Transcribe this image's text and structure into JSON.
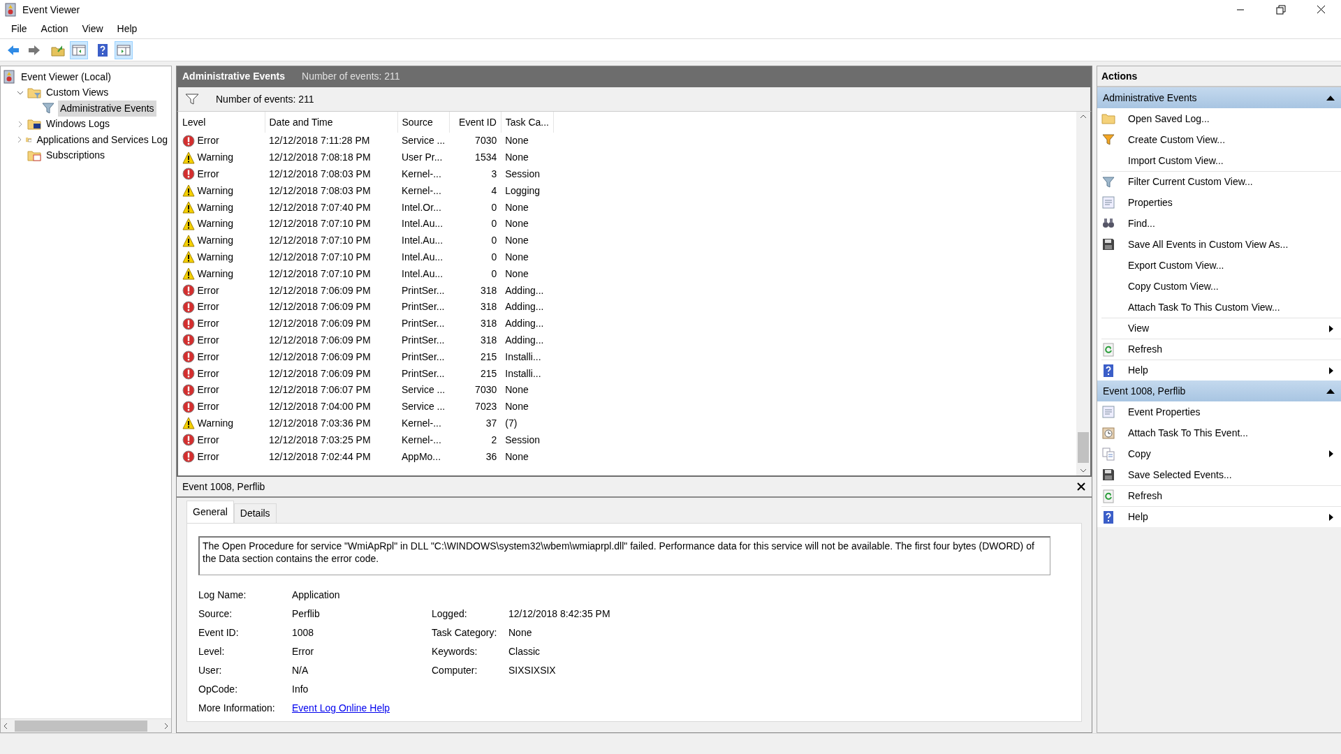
{
  "window": {
    "title": "Event Viewer"
  },
  "menu": [
    "File",
    "Action",
    "View",
    "Help"
  ],
  "toolbar": [
    {
      "pressed": false
    },
    {
      "pressed": false
    },
    {
      "pressed": false
    },
    {
      "pressed": true
    },
    {
      "pressed": false
    },
    {
      "pressed": true
    }
  ],
  "tree": [
    {
      "label": "Event Viewer (Local)",
      "selected": false,
      "children": [
        {
          "label": "Custom Views",
          "selected": false,
          "expanded": true,
          "children": [
            {
              "label": "Administrative Events",
              "selected": true
            }
          ]
        },
        {
          "label": "Windows Logs",
          "selected": false,
          "expanded": false
        },
        {
          "label": "Applications and Services Log",
          "selected": false,
          "expanded": false
        },
        {
          "label": "Subscriptions",
          "selected": false
        }
      ]
    }
  ],
  "center": {
    "title": "Administrative Events",
    "subtitle": "Number of events: 211",
    "filter_text": "Number of events: 211",
    "columns": [
      "Level",
      "Date and Time",
      "Source",
      "Event ID",
      "Task Ca..."
    ],
    "rows": [
      {
        "kind": "error",
        "cells": [
          "Error",
          "12/12/2018 7:11:28 PM",
          "Service ...",
          "7030",
          "None"
        ]
      },
      {
        "kind": "warning",
        "cells": [
          "Warning",
          "12/12/2018 7:08:18 PM",
          "User Pr...",
          "1534",
          "None"
        ]
      },
      {
        "kind": "error",
        "cells": [
          "Error",
          "12/12/2018 7:08:03 PM",
          "Kernel-...",
          "3",
          "Session"
        ]
      },
      {
        "kind": "warning",
        "cells": [
          "Warning",
          "12/12/2018 7:08:03 PM",
          "Kernel-...",
          "4",
          "Logging"
        ]
      },
      {
        "kind": "warning",
        "cells": [
          "Warning",
          "12/12/2018 7:07:40 PM",
          "Intel.Or...",
          "0",
          "None"
        ]
      },
      {
        "kind": "warning",
        "cells": [
          "Warning",
          "12/12/2018 7:07:10 PM",
          "Intel.Au...",
          "0",
          "None"
        ]
      },
      {
        "kind": "warning",
        "cells": [
          "Warning",
          "12/12/2018 7:07:10 PM",
          "Intel.Au...",
          "0",
          "None"
        ]
      },
      {
        "kind": "warning",
        "cells": [
          "Warning",
          "12/12/2018 7:07:10 PM",
          "Intel.Au...",
          "0",
          "None"
        ]
      },
      {
        "kind": "warning",
        "cells": [
          "Warning",
          "12/12/2018 7:07:10 PM",
          "Intel.Au...",
          "0",
          "None"
        ]
      },
      {
        "kind": "error",
        "cells": [
          "Error",
          "12/12/2018 7:06:09 PM",
          "PrintSer...",
          "318",
          "Adding..."
        ]
      },
      {
        "kind": "error",
        "cells": [
          "Error",
          "12/12/2018 7:06:09 PM",
          "PrintSer...",
          "318",
          "Adding..."
        ]
      },
      {
        "kind": "error",
        "cells": [
          "Error",
          "12/12/2018 7:06:09 PM",
          "PrintSer...",
          "318",
          "Adding..."
        ]
      },
      {
        "kind": "error",
        "cells": [
          "Error",
          "12/12/2018 7:06:09 PM",
          "PrintSer...",
          "318",
          "Adding..."
        ]
      },
      {
        "kind": "error",
        "cells": [
          "Error",
          "12/12/2018 7:06:09 PM",
          "PrintSer...",
          "215",
          "Installi..."
        ]
      },
      {
        "kind": "error",
        "cells": [
          "Error",
          "12/12/2018 7:06:09 PM",
          "PrintSer...",
          "215",
          "Installi..."
        ]
      },
      {
        "kind": "error",
        "cells": [
          "Error",
          "12/12/2018 7:06:07 PM",
          "Service ...",
          "7030",
          "None"
        ]
      },
      {
        "kind": "error",
        "cells": [
          "Error",
          "12/12/2018 7:04:00 PM",
          "Service ...",
          "7023",
          "None"
        ]
      },
      {
        "kind": "warning",
        "cells": [
          "Warning",
          "12/12/2018 7:03:36 PM",
          "Kernel-...",
          "37",
          "(7)"
        ]
      },
      {
        "kind": "error",
        "cells": [
          "Error",
          "12/12/2018 7:03:25 PM",
          "Kernel-...",
          "2",
          "Session"
        ]
      },
      {
        "kind": "error",
        "cells": [
          "Error",
          "12/12/2018 7:02:44 PM",
          "AppMo...",
          "36",
          "None"
        ]
      }
    ]
  },
  "detail": {
    "title": "Event 1008, Perflib",
    "tabs": [
      {
        "label": "General",
        "selected": true
      },
      {
        "label": "Details",
        "selected": false
      }
    ],
    "description": "The Open Procedure for service \"WmiApRpl\" in DLL \"C:\\WINDOWS\\system32\\wbem\\wmiaprpl.dll\" failed. Performance data for this service will not be available. The first four bytes (DWORD) of the Data section contains the error code.",
    "rows": [
      {
        "left": {
          "label": "Log Name:",
          "value": "Application"
        }
      },
      {
        "left": {
          "label": "Source:",
          "value": "Perflib"
        },
        "right": {
          "label": "Logged:",
          "value": "12/12/2018 8:42:35 PM"
        }
      },
      {
        "left": {
          "label": "Event ID:",
          "value": "1008"
        },
        "right": {
          "label": "Task Category:",
          "value": "None"
        }
      },
      {
        "left": {
          "label": "Level:",
          "value": "Error"
        },
        "right": {
          "label": "Keywords:",
          "value": "Classic"
        }
      },
      {
        "left": {
          "label": "User:",
          "value": "N/A"
        },
        "right": {
          "label": "Computer:",
          "value": "SIXSIXSIX"
        }
      },
      {
        "left": {
          "label": "OpCode:",
          "value": "Info"
        }
      }
    ],
    "more_info": {
      "label": "More Information:",
      "link": "Event Log Online Help"
    }
  },
  "actions": {
    "title": "Actions",
    "sections": [
      {
        "title": "Administrative Events",
        "expanded": true,
        "items": [
          {
            "label": "Open Saved Log...",
            "submenu": false,
            "separator": false
          },
          {
            "label": "Create Custom View...",
            "submenu": false,
            "separator": false
          },
          {
            "label": "Import Custom View...",
            "submenu": false,
            "separator": false
          },
          {
            "label": "Filter Current Custom View...",
            "submenu": false,
            "separator": true
          },
          {
            "label": "Properties",
            "submenu": false,
            "separator": false
          },
          {
            "label": "Find...",
            "submenu": false,
            "separator": false
          },
          {
            "label": "Save All Events in Custom View As...",
            "submenu": false,
            "separator": false
          },
          {
            "label": "Export Custom View...",
            "submenu": false,
            "separator": false
          },
          {
            "label": "Copy Custom View...",
            "submenu": false,
            "separator": false
          },
          {
            "label": "Attach Task To This Custom View...",
            "submenu": false,
            "separator": false
          },
          {
            "label": "View",
            "submenu": true,
            "separator": true
          },
          {
            "label": "Refresh",
            "submenu": false,
            "separator": true
          },
          {
            "label": "Help",
            "submenu": true,
            "separator": true
          }
        ]
      },
      {
        "title": "Event 1008, Perflib",
        "expanded": true,
        "items": [
          {
            "label": "Event Properties",
            "submenu": false,
            "separator": false
          },
          {
            "label": "Attach Task To This Event...",
            "submenu": false,
            "separator": false
          },
          {
            "label": "Copy",
            "submenu": true,
            "separator": false
          },
          {
            "label": "Save Selected Events...",
            "submenu": false,
            "separator": false
          },
          {
            "label": "Refresh",
            "submenu": false,
            "separator": true
          },
          {
            "label": "Help",
            "submenu": true,
            "separator": true
          }
        ]
      }
    ]
  }
}
